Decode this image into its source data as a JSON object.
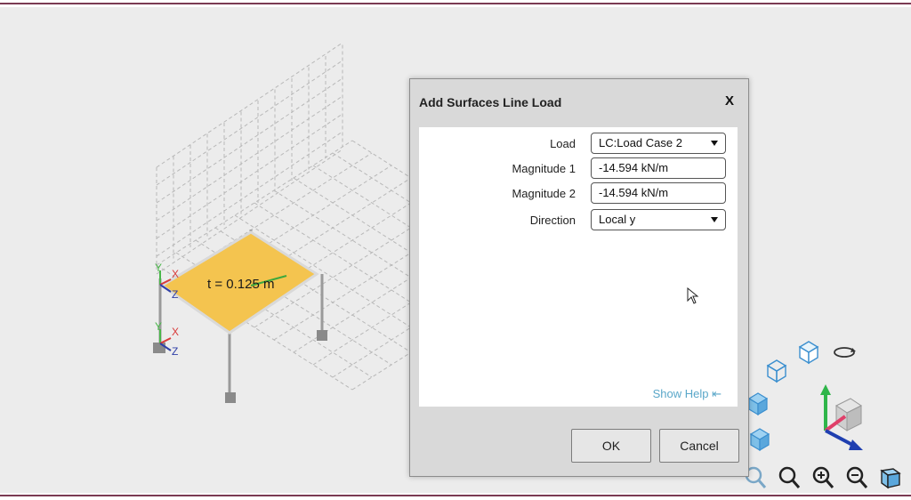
{
  "viewport": {
    "surface_label": "t = 0.125 m",
    "axis_labels": {
      "x": "X",
      "y": "Y",
      "z": "Z"
    },
    "surface_color": "#f4c44f"
  },
  "dialog": {
    "title": "Add Surfaces Line Load",
    "close_label": "X",
    "fields": {
      "load": {
        "label": "Load",
        "value": "LC:Load Case 2"
      },
      "magnitude1": {
        "label": "Magnitude 1",
        "value": "-14.594 kN/m"
      },
      "magnitude2": {
        "label": "Magnitude 2",
        "value": "-14.594 kN/m"
      },
      "direction": {
        "label": "Direction",
        "value": "Local y"
      }
    },
    "show_help": "Show Help ⇤",
    "ok_label": "OK",
    "cancel_label": "Cancel"
  },
  "view_tools": [
    "view-cube-icon",
    "wireframe-cube-icon",
    "rotate-icon",
    "solid-cube-icon",
    "axes-gizmo-icon",
    "zoom-extents-icon",
    "zoom-in-icon",
    "zoom-out-icon",
    "perspective-icon"
  ],
  "colors": {
    "accent": "#5aa7c9",
    "frame": "#7a3a52",
    "cube": "#7ec0e8"
  }
}
